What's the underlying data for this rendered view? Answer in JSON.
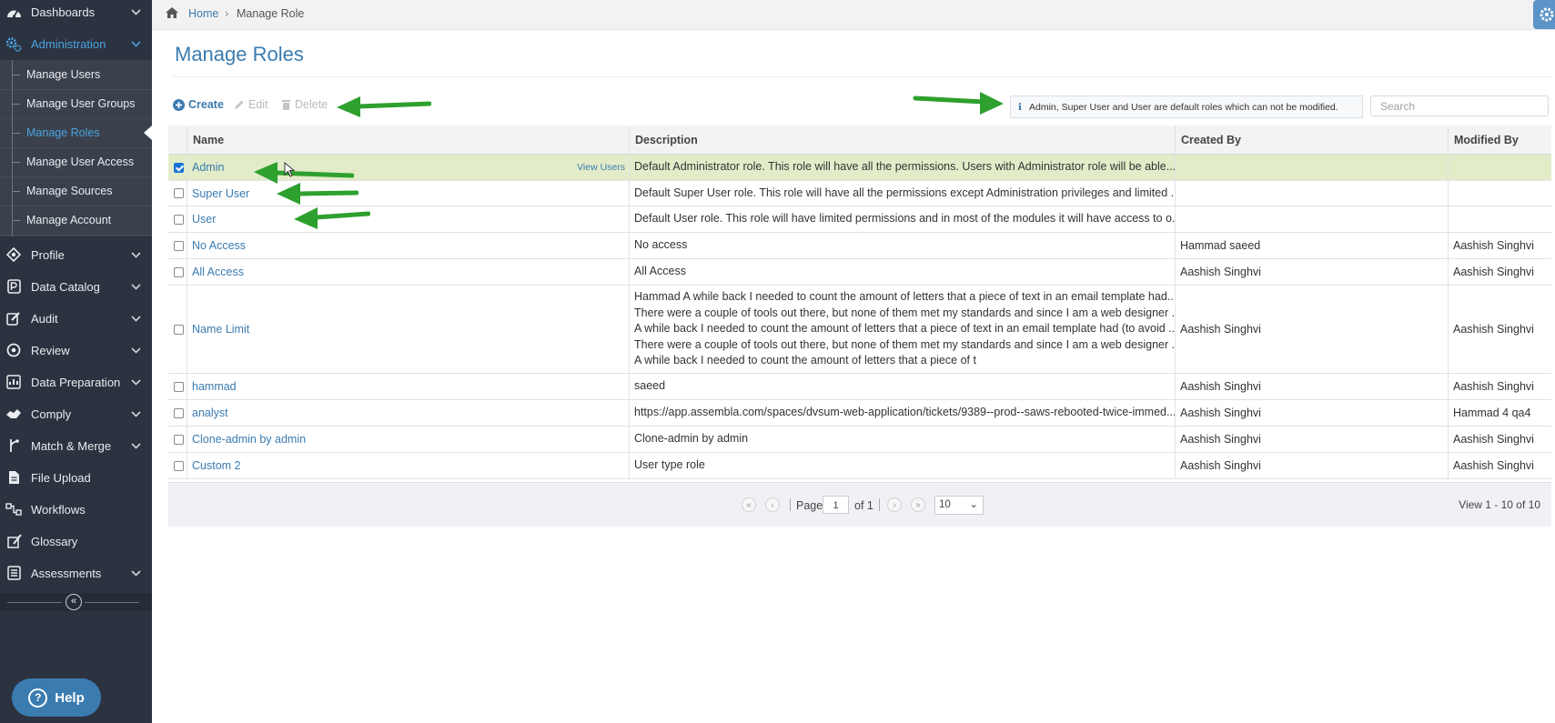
{
  "sidebar": {
    "items": [
      {
        "label": "Dashboards",
        "icon": "dashboard-icon"
      },
      {
        "label": "Administration",
        "icon": "cogs-icon"
      },
      {
        "label": "Profile",
        "icon": "profile-icon"
      },
      {
        "label": "Data Catalog",
        "icon": "catalog-icon"
      },
      {
        "label": "Audit",
        "icon": "audit-icon"
      },
      {
        "label": "Review",
        "icon": "review-icon"
      },
      {
        "label": "Data Preparation",
        "icon": "preparation-icon"
      },
      {
        "label": "Comply",
        "icon": "comply-icon"
      },
      {
        "label": "Match & Merge",
        "icon": "merge-icon"
      },
      {
        "label": "File Upload",
        "icon": "file-icon"
      },
      {
        "label": "Workflows",
        "icon": "workflow-icon"
      },
      {
        "label": "Glossary",
        "icon": "glossary-icon"
      },
      {
        "label": "Assessments",
        "icon": "assessments-icon"
      }
    ],
    "admin_sub": [
      {
        "label": "Manage Users"
      },
      {
        "label": "Manage User Groups"
      },
      {
        "label": "Manage Roles"
      },
      {
        "label": "Manage User Access"
      },
      {
        "label": "Manage Sources"
      },
      {
        "label": "Manage Account"
      }
    ],
    "collapse_glyph": "«",
    "help_label": "Help",
    "help_glyph": "?"
  },
  "breadcrumb": {
    "home": "Home",
    "separator": "›",
    "current": "Manage Role"
  },
  "page_title": "Manage Roles",
  "toolbar": {
    "create": "Create",
    "edit": "Edit",
    "delete": "Delete",
    "notice_glyph": "i",
    "notice": "Admin, Super User and User are default roles which can not be modified.",
    "search_placeholder": "Search"
  },
  "table": {
    "columns": [
      "Name",
      "Description",
      "Created By",
      "Modified By"
    ],
    "view_users_label": "View Users",
    "rows": [
      {
        "checked": true,
        "name": "Admin",
        "description": [
          "Default Administrator role. This role will have all the permissions. Users with Administrator role will be able..."
        ],
        "created_by": "",
        "modified_by": ""
      },
      {
        "checked": false,
        "name": "Super User",
        "description": [
          "Default Super User role. This role will have all the permissions except Administration privileges and limited ..."
        ],
        "created_by": "",
        "modified_by": ""
      },
      {
        "checked": false,
        "name": "User",
        "description": [
          "Default User role. This role will have limited permissions and in most of the modules it will have access to o..."
        ],
        "created_by": "",
        "modified_by": ""
      },
      {
        "checked": false,
        "name": "No Access",
        "description": [
          "No access"
        ],
        "created_by": "Hammad saeed",
        "modified_by": "Aashish Singhvi"
      },
      {
        "checked": false,
        "name": "All Access",
        "description": [
          "All Access"
        ],
        "created_by": "Aashish Singhvi",
        "modified_by": "Aashish Singhvi"
      },
      {
        "checked": false,
        "name": "Name Limit",
        "description": [
          "Hammad A while back I needed to count the amount of letters that a piece of text in an email template had...",
          "There were a couple of tools out there, but none of them met my standards and since I am a web designer ...",
          "A while back I needed to count the amount of letters that a piece of text in an email template had (to avoid ...",
          "There were a couple of tools out there, but none of them met my standards and since I am a web designer ...",
          "A while back I needed to count the amount of letters that a piece of t"
        ],
        "created_by": "Aashish Singhvi",
        "modified_by": "Aashish Singhvi"
      },
      {
        "checked": false,
        "name": "hammad",
        "description": [
          "saeed"
        ],
        "created_by": "Aashish Singhvi",
        "modified_by": "Aashish Singhvi"
      },
      {
        "checked": false,
        "name": "analyst",
        "description": [
          "https://app.assembla.com/spaces/dvsum-web-application/tickets/9389--prod--saws-rebooted-twice-immed..."
        ],
        "created_by": "Aashish Singhvi",
        "modified_by": "Hammad 4 qa4"
      },
      {
        "checked": false,
        "name": "Clone-admin by admin",
        "description": [
          "Clone-admin by admin"
        ],
        "created_by": "Aashish Singhvi",
        "modified_by": "Aashish Singhvi"
      },
      {
        "checked": false,
        "name": "Custom 2",
        "description": [
          "User type role"
        ],
        "created_by": "Aashish Singhvi",
        "modified_by": "Aashish Singhvi"
      }
    ]
  },
  "pager": {
    "first_glyph": "«",
    "prev_glyph": "‹",
    "next_glyph": "›",
    "last_glyph": "»",
    "page_label": "Page",
    "page_value": "1",
    "of_label": "of 1",
    "rows_per_page": "10",
    "select_caret": "⌄",
    "view_count": "View 1 - 10 of 10"
  },
  "colors": {
    "accent": "#3a7bb0",
    "sidebar_bg": "#2c3340",
    "selected_row": "#e2ecc9",
    "annotation_arrow": "#2ea02e"
  }
}
